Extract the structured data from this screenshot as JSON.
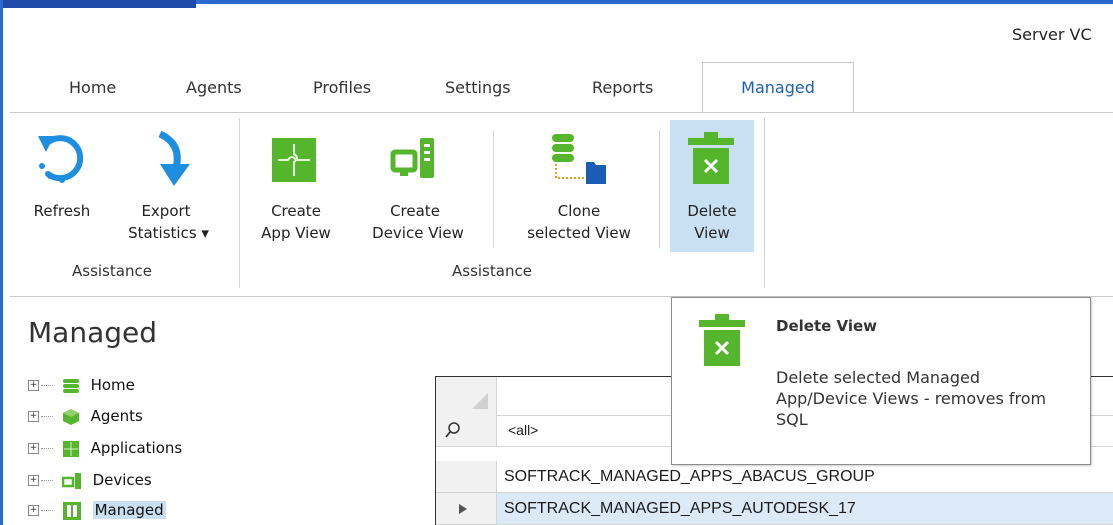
{
  "window": {
    "server_label": "Server VC"
  },
  "tabs": [
    {
      "label": "Home"
    },
    {
      "label": "Agents"
    },
    {
      "label": "Profiles"
    },
    {
      "label": "Settings"
    },
    {
      "label": "Reports"
    },
    {
      "label": "Managed",
      "active": true
    }
  ],
  "ribbon": {
    "refresh": "Refresh",
    "export_line1": "Export",
    "export_line2": "Statistics ▾",
    "group1": "Assistance",
    "create_app_line1": "Create",
    "create_app_line2": "App View",
    "create_device_line1": "Create",
    "create_device_line2": "Device View",
    "clone_line1": "Clone",
    "clone_line2": "selected View",
    "delete_line1": "Delete",
    "delete_line2": "View",
    "group2": "Assistance"
  },
  "sidebar": {
    "title": "Managed",
    "items": [
      {
        "label": "Home",
        "icon": "database-icon"
      },
      {
        "label": "Agents",
        "icon": "cube-icon"
      },
      {
        "label": "Applications",
        "icon": "puzzle-icon"
      },
      {
        "label": "Devices",
        "icon": "device-icon"
      },
      {
        "label": "Managed",
        "icon": "managed-icon"
      }
    ]
  },
  "grid": {
    "filter_value": "<all>",
    "rows": [
      "SOFTRACK_MANAGED_APPS_ABACUS_GROUP",
      "SOFTRACK_MANAGED_APPS_AUTODESK_17"
    ]
  },
  "tooltip": {
    "title": "Delete View",
    "description": "Delete selected Managed App/Device Views - removes from SQL"
  },
  "colors": {
    "accent": "#1d5fb0",
    "icon_blue": "#1e8fe0",
    "icon_green": "#55b52c",
    "selected_bg": "#c9e0f3"
  }
}
